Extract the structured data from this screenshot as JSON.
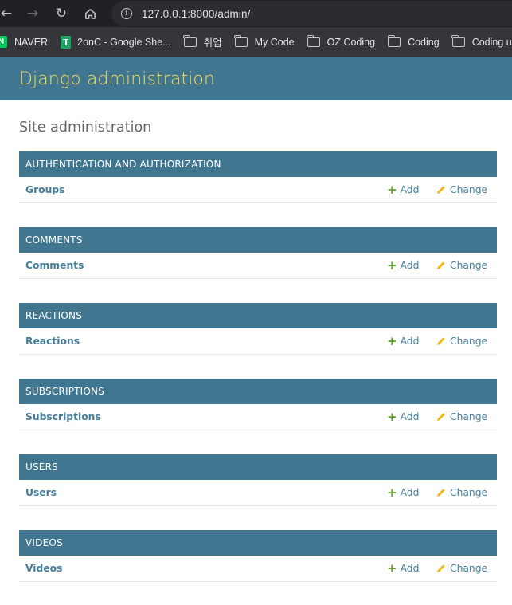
{
  "browser": {
    "url": "127.0.0.1:8000/admin/",
    "bookmarks": [
      {
        "label": "NAVER",
        "icon": "naver-icon"
      },
      {
        "label": "2onC - Google She...",
        "icon": "google-sheets-icon"
      },
      {
        "label": "취업",
        "icon": "folder-icon"
      },
      {
        "label": "My Code",
        "icon": "folder-icon"
      },
      {
        "label": "OZ Coding",
        "icon": "folder-icon"
      },
      {
        "label": "Coding",
        "icon": "folder-icon"
      },
      {
        "label": "Coding u",
        "icon": "folder-icon"
      }
    ]
  },
  "header": {
    "title": "Django administration"
  },
  "main": {
    "title": "Site administration",
    "modules": [
      {
        "caption": "AUTHENTICATION AND AUTHORIZATION",
        "model": "Groups",
        "add_label": "Add",
        "change_label": "Change"
      },
      {
        "caption": "COMMENTS",
        "model": "Comments",
        "add_label": "Add",
        "change_label": "Change"
      },
      {
        "caption": "REACTIONS",
        "model": "Reactions",
        "add_label": "Add",
        "change_label": "Change"
      },
      {
        "caption": "SUBSCRIPTIONS",
        "model": "Subscriptions",
        "add_label": "Add",
        "change_label": "Change"
      },
      {
        "caption": "USERS",
        "model": "Users",
        "add_label": "Add",
        "change_label": "Change"
      },
      {
        "caption": "VIDEOS",
        "model": "Videos",
        "add_label": "Add",
        "change_label": "Change"
      }
    ]
  },
  "colors": {
    "header_bg": "#417690",
    "header_title": "#f5dd5d",
    "link": "#447e9b",
    "add_icon": "#5fa225",
    "change_icon": "#efb80b"
  }
}
